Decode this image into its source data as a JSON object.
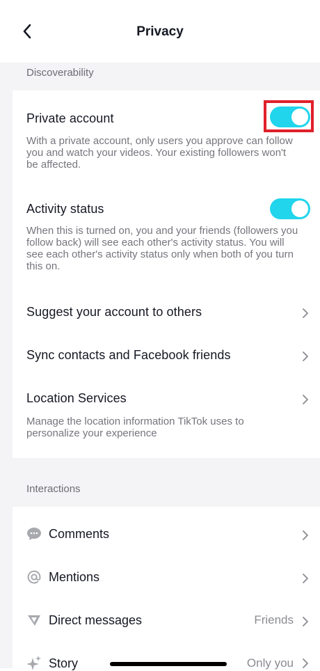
{
  "header": {
    "title": "Privacy",
    "back_icon": "chevron-left-icon"
  },
  "discoverability": {
    "section_label": "Discoverability",
    "private_account": {
      "title": "Private account",
      "description": "With a private account, only users you approve can follow you and watch your videos. Your existing followers won't be affected.",
      "enabled": true
    },
    "activity_status": {
      "title": "Activity status",
      "description": "When this is turned on, you and your friends (followers you follow back) will see each other's activity status. You will see each other's activity status only when both of you turn this on.",
      "enabled": true
    },
    "suggest_account": {
      "title": "Suggest your account to others"
    },
    "sync_contacts": {
      "title": "Sync contacts and Facebook friends"
    },
    "location_services": {
      "title": "Location Services",
      "description": "Manage the location information TikTok uses to personalize your experience"
    }
  },
  "interactions": {
    "section_label": "Interactions",
    "items": [
      {
        "label": "Comments",
        "icon": "comment-bubble-icon",
        "value": ""
      },
      {
        "label": "Mentions",
        "icon": "at-sign-icon",
        "value": ""
      },
      {
        "label": "Direct messages",
        "icon": "send-icon",
        "value": "Friends"
      },
      {
        "label": "Story",
        "icon": "sparkle-icon",
        "value": "Only you"
      }
    ]
  },
  "colors": {
    "toggle_on": "#20d5ec",
    "highlight": "#e0202b",
    "section_bg": "#f4f4f6"
  }
}
